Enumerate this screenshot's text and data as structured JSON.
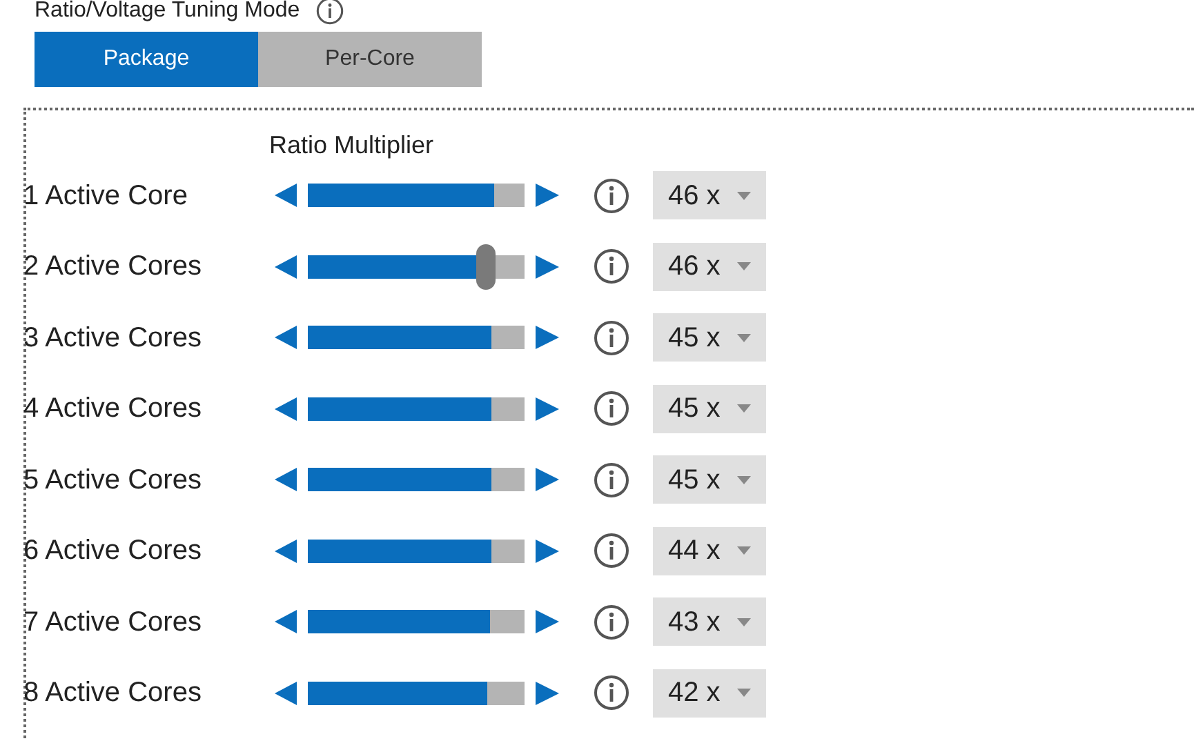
{
  "section_title": "Ratio/Voltage Tuning Mode",
  "tabs": [
    {
      "label": "Package",
      "selected": true
    },
    {
      "label": "Per-Core",
      "selected": false
    }
  ],
  "column_header": "Ratio Multiplier",
  "rows": [
    {
      "label": "1 Active Core",
      "level": 0.86,
      "thumb": false,
      "value": "46 x"
    },
    {
      "label": "2 Active Cores",
      "level": 0.82,
      "thumb": true,
      "value": "46 x"
    },
    {
      "label": "3 Active Cores",
      "level": 0.85,
      "thumb": false,
      "value": "45 x"
    },
    {
      "label": "4 Active Cores",
      "level": 0.85,
      "thumb": false,
      "value": "45 x"
    },
    {
      "label": "5 Active Cores",
      "level": 0.85,
      "thumb": false,
      "value": "45 x"
    },
    {
      "label": "6 Active Cores",
      "level": 0.845,
      "thumb": false,
      "value": "44 x"
    },
    {
      "label": "7 Active Cores",
      "level": 0.84,
      "thumb": false,
      "value": "43 x"
    },
    {
      "label": "8 Active Cores",
      "level": 0.83,
      "thumb": false,
      "value": "42 x"
    }
  ]
}
